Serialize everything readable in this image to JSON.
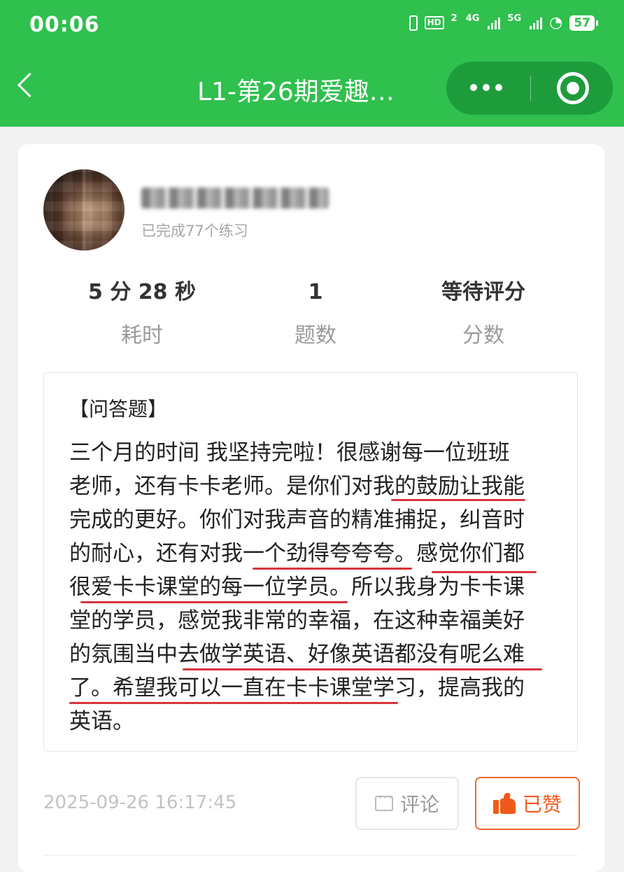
{
  "status_bar": {
    "time": "00:06",
    "hd_label": "HD",
    "hd_sub": "2",
    "network1": "4G",
    "network2": "5G",
    "battery": "57"
  },
  "nav": {
    "title": "L1-第26期爱趣…"
  },
  "user": {
    "completed_text": "已完成77个练习"
  },
  "stats": [
    {
      "value": "5 分 28 秒",
      "label": "耗时"
    },
    {
      "value": "1",
      "label": "题数"
    },
    {
      "value": "等待评分",
      "label": "分数"
    }
  ],
  "question": {
    "type": "【问答题】",
    "lines": [
      "三个月的时间 我坚持完啦！很感谢每一位班班",
      "老师，还有卡卡老师。是你们对我的鼓励让我能",
      "完成的更好。你们对我声音的精准捕捉，纠音时",
      "的耐心，还有对我一个劲得夸夸夸。感觉你们都",
      "很爱卡卡课堂的每一位学员。所以我身为卡卡课",
      "堂的学员，感觉我非常的幸福，在这种幸福美好",
      "的氛围当中去做学英语、好像英语都没有呢么难",
      "了。希望我可以一直在卡卡课堂学习，提高我的",
      "英语。"
    ]
  },
  "footer": {
    "timestamp": "2025-09-26 16:17:45",
    "comment_label": "评论",
    "like_label": "已赞"
  },
  "colors": {
    "brand_green": "#2fc04e",
    "capsule_green": "#1e9c3c",
    "like_orange": "#ef5a1a",
    "underline_red": "#d9353d"
  }
}
